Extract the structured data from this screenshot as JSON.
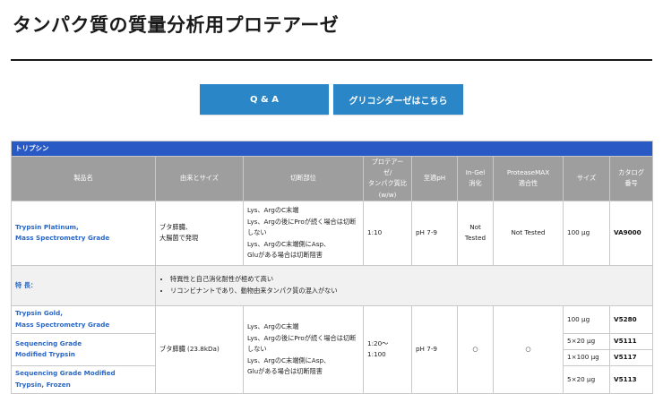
{
  "page": {
    "title": "タンパク質の質量分析用プロテアーゼ"
  },
  "buttons": {
    "qa": "Q & A",
    "glyco": "グリコシダーゼはこちら"
  },
  "table": {
    "category": "トリプシン",
    "headers": [
      "製品名",
      "由来とサイズ",
      "切断部位",
      "プロテアーゼ/\nタンパク質比\n(w/w)",
      "至適pH",
      "In-Gel\n消化",
      "ProteaseMAX\n適合性",
      "サイズ",
      "カタログ\n番号"
    ],
    "row1": {
      "name_line1": "Trypsin Platinum,",
      "name_line2": "Mass Spectrometry Grade",
      "origin_line1": "ブタ膵臓、",
      "origin_line2": "大腸菌で発現",
      "cleavage_1": "Lys、ArgのC末端",
      "cleavage_2": "Lys、Argの後にProが続く場合は切断",
      "cleavage_3": "しない",
      "cleavage_4": "Lys、ArgのC末端側にAsp、",
      "cleavage_5": "Gluがある場合は切断阻害",
      "ratio": "1:10",
      "ph": "pH 7-9",
      "ingel_line1": "Not",
      "ingel_line2": "Tested",
      "proteasemax": "Not Tested",
      "size": "100 µg",
      "catalog": "VA9000"
    },
    "features": {
      "label": "特 長：",
      "item1": "特異性と自己消化耐性が極めて高い",
      "item2": "リコンビナントであり、動物由来タンパク質の混入がない"
    },
    "group": {
      "gold_line1": "Trypsin Gold,",
      "gold_line2": "Mass Spectrometry Grade",
      "seq_line1": "Sequencing Grade",
      "seq_line2": "Modified Trypsin",
      "seqf_line1": "Sequencing Grade Modified",
      "seqf_line2": "Trypsin, Frozen",
      "origin": "ブタ膵臓 (23.8kDa)",
      "cleavage_1": "Lys、ArgのC末端",
      "cleavage_2": "Lys、Argの後にProが続く場合は切断",
      "cleavage_3": "しない",
      "cleavage_4": "Lys、ArgのC末端側にAsp、",
      "cleavage_5": "Gluがある場合は切断阻害",
      "ratio_line1": "1:20～",
      "ratio_line2": "1:100",
      "ph": "pH 7-9",
      "ingel": "○",
      "proteasemax": "○",
      "gold_size": "100 µg",
      "gold_cat": "V5280",
      "seq_size1": "5×20 µg",
      "seq_cat1": "V5111",
      "seq_size2": "1×100 µg",
      "seq_cat2": "V5117",
      "seqf_size": "5×20 µg",
      "seqf_cat": "V5113"
    }
  }
}
